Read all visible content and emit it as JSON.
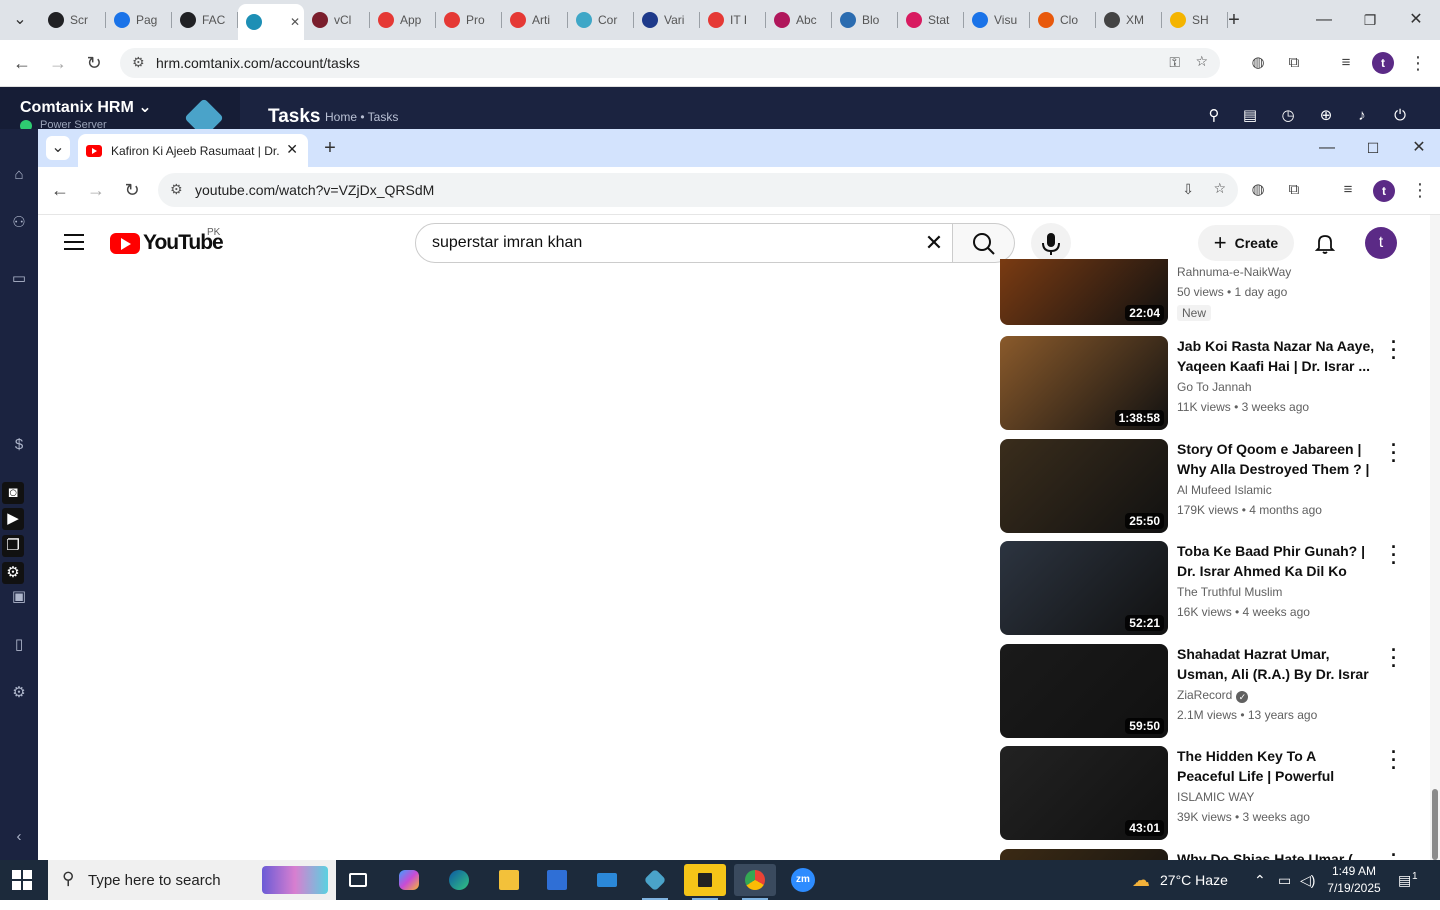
{
  "outer_browser": {
    "tabs": [
      {
        "label": "Scr",
        "color": "#202124"
      },
      {
        "label": "Pag",
        "color": "#1a73e8"
      },
      {
        "label": "FAC",
        "color": "#202124"
      },
      {
        "label": "",
        "color": "#1d8fb5"
      },
      {
        "label": "vCl",
        "color": "#7a1e2c"
      },
      {
        "label": "App",
        "color": "#e53935"
      },
      {
        "label": "Pro",
        "color": "#e53935"
      },
      {
        "label": "Arti",
        "color": "#e53935"
      },
      {
        "label": "Cor",
        "color": "#3fa7c7"
      },
      {
        "label": "Vari",
        "color": "#1e3a8a"
      },
      {
        "label": "IT I",
        "color": "#e53935"
      },
      {
        "label": "Abc",
        "color": "#b0175b"
      },
      {
        "label": "Blo",
        "color": "#2b6cb0"
      },
      {
        "label": "Stat",
        "color": "#d81b60"
      },
      {
        "label": "Visu",
        "color": "#1a73e8"
      },
      {
        "label": "Clo",
        "color": "#e8590c"
      },
      {
        "label": "XM",
        "color": "#444444"
      },
      {
        "label": "SH",
        "color": "#f4b400"
      }
    ],
    "url": "hrm.comtanix.com/account/tasks",
    "profile_initial": "t"
  },
  "hrm": {
    "brand": "Comtanix HRM",
    "status": "Power Server",
    "page_title": "Tasks",
    "breadcrumb": "Home • Tasks"
  },
  "yt_window": {
    "tab_title": "Kafiron Ki Ajeeb Rasumaat | Dr.",
    "url": "youtube.com/watch?v=VZjDx_QRSdM",
    "profile_initial": "t"
  },
  "youtube": {
    "logo_text": "YouTube",
    "country": "PK",
    "search_value": "superstar imran khan",
    "create_label": "Create",
    "avatar_initial": "t",
    "videos": [
      {
        "title": "",
        "channel": "Rahnuma-e-NaikWay",
        "meta": "50 views • 1 day ago",
        "duration": "22:04",
        "badge": "New",
        "verified": false,
        "bg": "#7a3b12"
      },
      {
        "title": "Jab Koi Rasta Nazar Na Aaye, Yaqeen Kaafi Hai | Dr. Israr ...",
        "channel": "Go To Jannah",
        "meta": "11K views • 3 weeks ago",
        "duration": "1:38:58",
        "badge": "",
        "verified": false,
        "bg": "#8a5a2b"
      },
      {
        "title": "Story Of Qoom e Jabareen | Why Alla Destroyed Them ? | ...",
        "channel": "Al Mufeed Islamic",
        "meta": "179K views • 4 months ago",
        "duration": "25:50",
        "badge": "",
        "verified": false,
        "bg": "#3a2d1c"
      },
      {
        "title": "Toba Ke Baad Phir Gunah? | Dr. Israr Ahmed Ka Dil Ko Hilane ...",
        "channel": "The Truthful Muslim",
        "meta": "16K views • 4 weeks ago",
        "duration": "52:21",
        "badge": "",
        "verified": false,
        "bg": "#2c3440"
      },
      {
        "title": "Shahadat Hazrat Umar, Usman, Ali (R.A.) By Dr. Israr Ahmed ...",
        "channel": "ZiaRecord",
        "meta": "2.1M views • 13 years ago",
        "duration": "59:50",
        "badge": "",
        "verified": true,
        "bg": "#1a1a1a"
      },
      {
        "title": "The Hidden Key To A Peaceful Life | Powerful Islamic ...",
        "channel": "ISLAMIC WAY",
        "meta": "39K views • 3 weeks ago",
        "duration": "43:01",
        "badge": "",
        "verified": false,
        "bg": "#222222"
      },
      {
        "title": "Why Do Shias Hate Umar (...",
        "channel": "",
        "meta": "",
        "duration": "",
        "badge": "",
        "verified": false,
        "bg": "#3b2a14"
      }
    ]
  },
  "taskbar": {
    "search_placeholder": "Type here to search",
    "weather": "27°C  Haze",
    "time": "1:49 AM",
    "date": "7/19/2025",
    "notification_count": "1"
  }
}
